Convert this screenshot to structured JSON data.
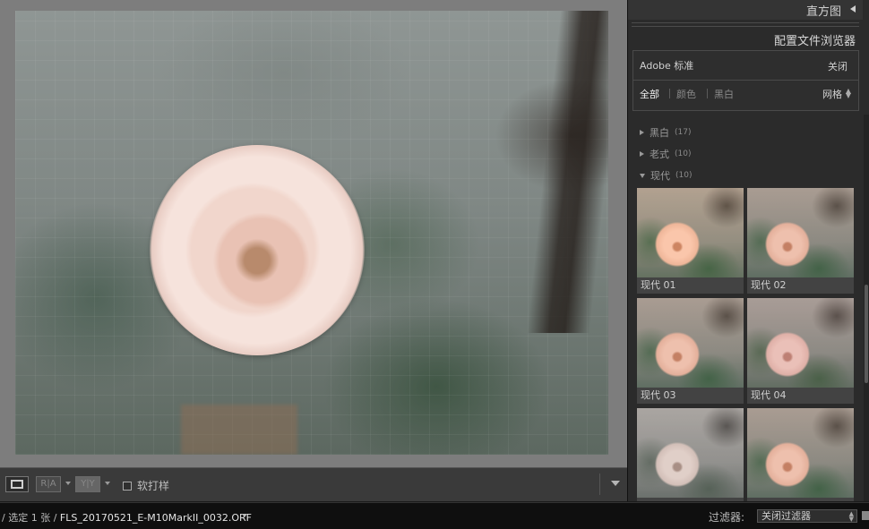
{
  "toolbar": {
    "before_after_label": "R|A",
    "yy_label": "Y|Y",
    "soft_proof_label": "软打样"
  },
  "right_panel": {
    "histogram_title": "直方图",
    "profile_browser_title": "配置文件浏览器",
    "profile_name": "Adobe 标准",
    "close_label": "关闭",
    "tabs": [
      {
        "label": "全部",
        "active": true
      },
      {
        "label": "颜色",
        "active": false
      },
      {
        "label": "黑白",
        "active": false
      }
    ],
    "view_mode": "网格",
    "groups": [
      {
        "name": "黑白",
        "count": "(17)",
        "expanded": false
      },
      {
        "name": "老式",
        "count": "(10)",
        "expanded": false
      },
      {
        "name": "现代",
        "count": "(10)",
        "expanded": true
      }
    ],
    "thumbnails": [
      {
        "label": "现代 01"
      },
      {
        "label": "现代 02"
      },
      {
        "label": "现代 03"
      },
      {
        "label": "现代 04"
      },
      {
        "label": ""
      },
      {
        "label": ""
      }
    ]
  },
  "status_bar": {
    "selection_text": "/ 选定 1 张 /",
    "file_name": "FLS_20170521_E-M10MarkII_0032.ORF",
    "filter_label": "过滤器:",
    "filter_value": "关闭过滤器"
  },
  "colors": {
    "accent": "#f0f0f0",
    "panel_bg": "#2b2b2b",
    "main_bg": "#7d7d7d"
  }
}
